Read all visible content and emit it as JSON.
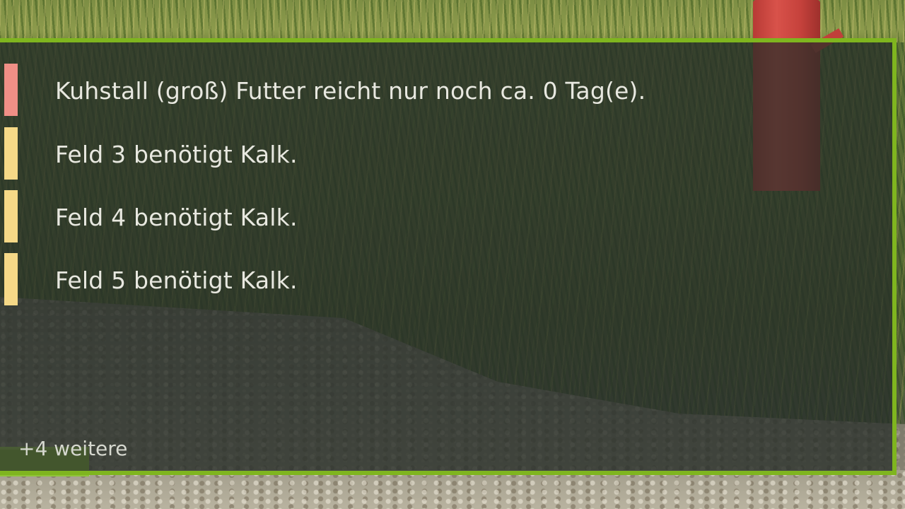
{
  "notifications": [
    {
      "text": "Kuhstall (groß) Futter reicht nur noch ca. 0 Tag(e).",
      "severity_color": "#f08f86"
    },
    {
      "text": "Feld 3 benötigt Kalk.",
      "severity_color": "#f6d987"
    },
    {
      "text": "Feld 4 benötigt Kalk.",
      "severity_color": "#f6d987"
    },
    {
      "text": "Feld 5 benötigt Kalk.",
      "severity_color": "#f6d987"
    }
  ],
  "more": {
    "label": "+4 weitere"
  },
  "colors": {
    "panel_border": "#7fb51f",
    "more_indicator": "#8fc33a"
  }
}
